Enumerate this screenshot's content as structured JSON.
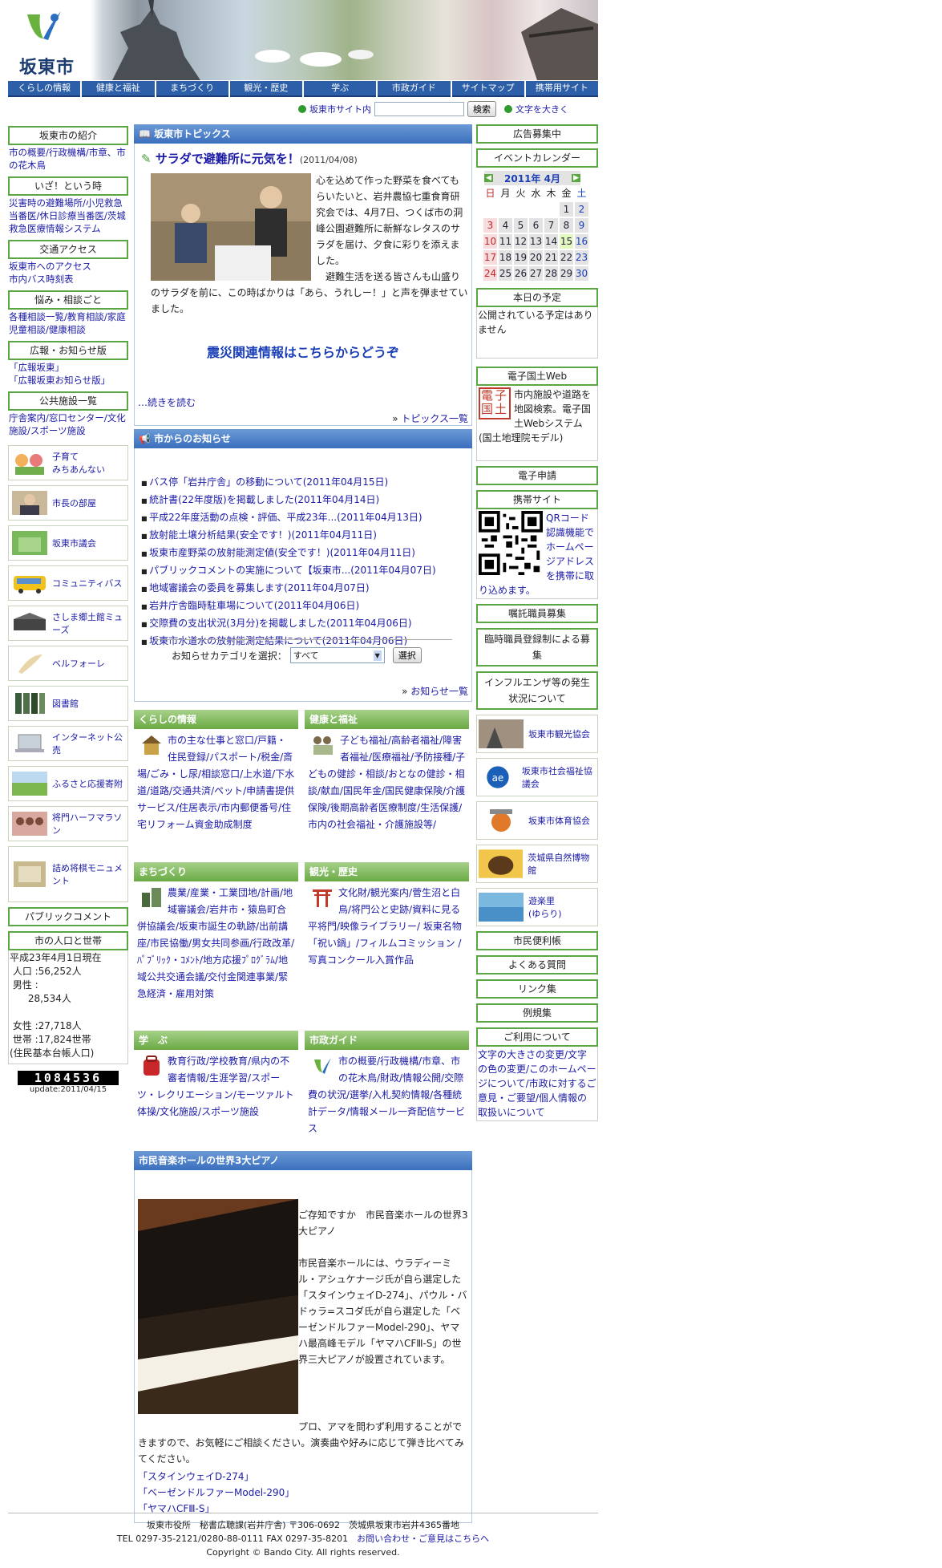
{
  "header": {
    "city_name": "坂東市"
  },
  "nav": [
    "くらしの情報",
    "健康と福祉",
    "まちづくり",
    "観光・歴史",
    "学ぶ",
    "市政ガイド",
    "サイトマップ",
    "携帯用サイト"
  ],
  "search": {
    "scope_label": "坂東市サイト内",
    "button": "検索",
    "text_size": "文字を大きく"
  },
  "left": {
    "intro_title": "坂東市の紹介",
    "intro_links": "市の概要/行政機構/市章、市の花木鳥",
    "emergency_title": "いざ！という時",
    "emergency_links": "災害時の避難場所/小児救急当番医/休日診療当番医/茨城救急医療情報システム",
    "traffic_title": "交通アクセス",
    "traffic_links": "坂東市へのアクセス\n市内バス時刻表",
    "consult_title": "悩み・相談ごと",
    "consult_links": "各種相談一覧/教育相談/家庭児童相談/健康相談",
    "pr_title": "広報・お知らせ版",
    "pr_links": "「広報坂東」\n「広報坂東お知らせ版」",
    "facilities_title": "公共施設一覧",
    "facilities_links": "庁舎案内/窓口センター/文化施設/スポーツ施設",
    "banners": [
      "子育て\nみちあんない",
      "市長の部屋",
      "坂東市議会",
      "コミュニティバス",
      "さしま郷土館ミューズ",
      "ベルフォーレ",
      "図書館",
      "インターネット公売",
      "ふるさと応援寄附",
      "将門ハーフマラソン",
      "詰め将棋モニュメント"
    ],
    "public_comment": "パブリックコメント",
    "population_title": "市の人口と世帯",
    "population_text": "平成23年4月1日現在\n 人口 :56,252人\n 男性 :\n      28,534人\n\n 女性 :27,718人\n 世帯 :17,824世帯\n(住民基本台帳人口)",
    "counter": "1084536",
    "counter_update": "update:2011/04/15"
  },
  "topics": {
    "header": "坂東市トピックス",
    "headline": "サラダで避難所に元気を！",
    "date": "(2011/04/08)",
    "body": "心を込めて作った野菜を食べてもらいたいと、岩井農協七重食育研究会では、4月7日、つくば市の洞峰公園避難所に新鮮なレタスのサラダを届け、夕食に彩りを添えました。\n　避難生活を送る皆さんも山盛りのサラダを前に、この時ばかりは「あら、うれしー！」と声を弾ませていました。",
    "quake_link": "震災関連情報はこちらからどうぞ",
    "read_more": "…続きを読む",
    "list_link": "トピックス一覧"
  },
  "notices": {
    "header": "市からのお知らせ",
    "items": [
      "バス停「岩井庁舎」の移動について(2011年04月15日)",
      "統計書(22年度版)を掲載しました(2011年04月14日)",
      "平成22年度活動の点検・評価、平成23年...(2011年04月13日)",
      "放射能土壌分析結果(安全です！)(2011年04月11日)",
      "坂東市産野菜の放射能測定値(安全です！)(2011年04月11日)",
      "パブリックコメントの実施について【坂東市...(2011年04月07日)",
      "地域審議会の委員を募集します(2011年04月07日)",
      "岩井庁舎臨時駐車場について(2011年04月06日)",
      "交際費の支出状況(3月分)を掲載しました(2011年04月06日)",
      "坂東市水道水の放射能測定結果について(2011年04月06日)"
    ],
    "category_label": "お知らせカテゴリを選択：",
    "category_value": "すべて",
    "select_button": "選択",
    "list_link": "お知らせ一覧"
  },
  "sections": [
    {
      "title": "くらしの情報",
      "text": "市の主な仕事と窓口/戸籍・住民登録/パスポート/税金/斎場/ごみ・し尿/相談窓口/上水道/下水道/道路/交通共済/ペット/申請書提供サービス/住居表示/市内郵便番号/住宅リフォーム資金助成制度"
    },
    {
      "title": "健康と福祉",
      "text": "子ども福祉/高齢者福祉/障害者福祉/医療福祉/予防接種/子どもの健診・相談/おとなの健診・相談/献血/国民年金/国民健康保険/介護保険/後期高齢者医療制度/生活保護/市内の社会福祉・介護施設等/"
    },
    {
      "title": "まちづくり",
      "text": "農業/産業・工業団地/計画/地域審議会/岩井市・猿島町合併協議会/坂東市誕生の軌跡/出前講座/市民協働/男女共同参画/行政改革/ﾊﾟﾌﾞﾘｯｸ・ｺﾒﾝﾄ/地方応援ﾌﾟﾛｸﾞﾗﾑ/地域公共交通会議/交付金関連事業/緊急経済・雇用対策"
    },
    {
      "title": "観光・歴史",
      "text": "文化財/観光案内/菅生沼と白鳥/将門公と史跡/資料に見る平将門/映像ライブラリー/ 坂東名物「祝い鍋」/フィルムコミッション /写真コンクール入賞作品"
    },
    {
      "title": "学　ぶ",
      "text": "教育行政/学校教育/県内の不審者情報/生涯学習/スポーツ・レクリエーション/モーツァルト体操/文化施設/スポーツ施設"
    },
    {
      "title": "市政ガイド",
      "text": "市の概要/行政機構/市章、市の花木鳥/財政/情報公開/交際費の状況/選挙/入札契約情報/各種統計データ/情報メール一斉配信サービス"
    }
  ],
  "piano": {
    "header": "市民音楽ホールの世界3大ピアノ",
    "intro": "ご存知ですか　市民音楽ホールの世界3大ピアノ",
    "text": "市民音楽ホールには、ウラディーミル・アシュケナージ氏が自ら選定した「スタインウェイD-274」、パウル・バドゥラ=スコダ氏が自ら選定した「ベーゼンドルファーModel-290」、ヤマハ最高峰モデル「ヤマハCFⅢ-S」の世界三大ピアノが設置されています。",
    "text2": "プロ、アマを問わず利用することができますので、お気軽にご相談ください。演奏曲や好みに応じて弾き比べてみてください。",
    "links": [
      "「スタインウェイD-274」",
      "「ベーゼンドルファーModel-290」",
      "「ヤマハCFⅢ-S」"
    ]
  },
  "right": {
    "ad": "広告募集中",
    "event_calendar": "イベントカレンダー",
    "month": "2011年 4月",
    "weekdays": [
      "日",
      "月",
      "火",
      "水",
      "木",
      "金",
      "土"
    ],
    "today_schedule_title": "本日の予定",
    "today_schedule_text": "公開されている予定はありません",
    "gsi_title": "電子国土Web",
    "gsi_text": "市内施設や道路を地図検索。電子国土Webシステム(国土地理院モデル)",
    "gsi_icon": "電子国土",
    "e_application": "電子申請",
    "mobile_title": "携帯サイト",
    "mobile_text": "QRコード認識機能でホームページアドレスを携帯に取り込めます。",
    "recruit1": "嘱託職員募集",
    "recruit2": "臨時職員登録制による募集",
    "influenza": "インフルエンザ等の発生状況について",
    "banners": [
      "坂東市観光協会",
      "坂東市社会福祉協議会",
      "坂東市体育協会",
      "茨城県自然博物館",
      "遊楽里\n(ゆらり)"
    ],
    "links": [
      "市民便利帳",
      "よくある質問",
      "リンク集",
      "例規集"
    ],
    "usage_title": "ご利用について",
    "usage_text": "文字の大きさの変更/文字の色の変更/このホームページについて/市政に対するご意見・ご要望/個人情報の取扱いについて"
  },
  "calendar_weeks": [
    [
      "",
      "",
      "",
      "",
      "",
      "1",
      "2"
    ],
    [
      "3",
      "4",
      "5",
      "6",
      "7",
      "8",
      "9"
    ],
    [
      "10",
      "11",
      "12",
      "13",
      "14",
      "15",
      "16"
    ],
    [
      "17",
      "18",
      "19",
      "20",
      "21",
      "22",
      "23"
    ],
    [
      "24",
      "25",
      "26",
      "27",
      "28",
      "29",
      "30"
    ]
  ],
  "colors": {
    "nav": "#2c5fa8",
    "accent_green": "#5aa642",
    "section_green": "#6aaa44",
    "header_blue": "#3a6fbd",
    "link": "#1a1aa6",
    "saturday": "#1a3fb8",
    "sunday": "#c0282a",
    "today": "#e3f7c0"
  },
  "footer": {
    "line1": "坂東市役所　秘書広聴課(岩井庁舎) 〒306-0692　茨城県坂東市岩井4365番地",
    "line2": "TEL 0297-35-2121/0280-88-0111 FAX 0297-35-8201",
    "contact": "お問い合わせ・ご意見はこちらへ",
    "copyright": "Copyright © Bando City. All rights reserved."
  }
}
